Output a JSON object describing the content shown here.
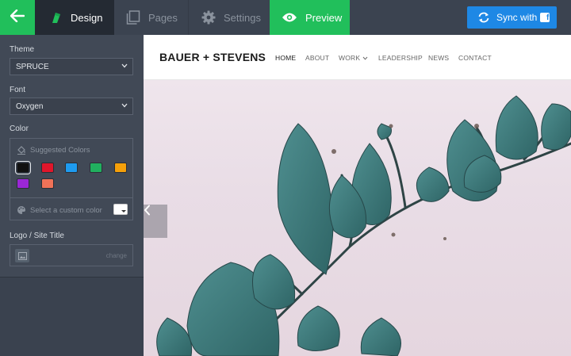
{
  "topbar": {
    "tabs": {
      "design": "Design",
      "pages": "Pages",
      "settings": "Settings",
      "preview": "Preview"
    },
    "sync_label": "Sync with",
    "icons": [
      "back-arrow-icon",
      "design-brush-icon",
      "pages-icon",
      "gear-icon",
      "eye-icon",
      "sync-icon",
      "facebook-icon"
    ]
  },
  "sidebar": {
    "theme_label": "Theme",
    "theme_value": "SPRUCE",
    "font_label": "Font",
    "font_value": "Oxygen",
    "color_label": "Color",
    "suggested_label": "Suggested Colors",
    "swatches": [
      "#111111",
      "#e0162b",
      "#1e9bf0",
      "#21b05f",
      "#f5a00a",
      "#9b27d6",
      "#f07258"
    ],
    "custom_color_label": "Select a custom color",
    "custom_color_value": "#ffffff",
    "logo_label": "Logo / Site Title",
    "logo_change": "change"
  },
  "site": {
    "brand": "BAUER + STEVENS",
    "nav": [
      "HOME",
      "ABOUT",
      "WORK",
      "LEADERSHIP",
      "NEWS",
      "CONTACT"
    ],
    "active_nav": "HOME"
  },
  "colors": {
    "accent_green": "#21bf5b",
    "sync_blue": "#1e88e5",
    "sidebar_bg": "#414956",
    "topbar_bg": "#3b4350"
  }
}
